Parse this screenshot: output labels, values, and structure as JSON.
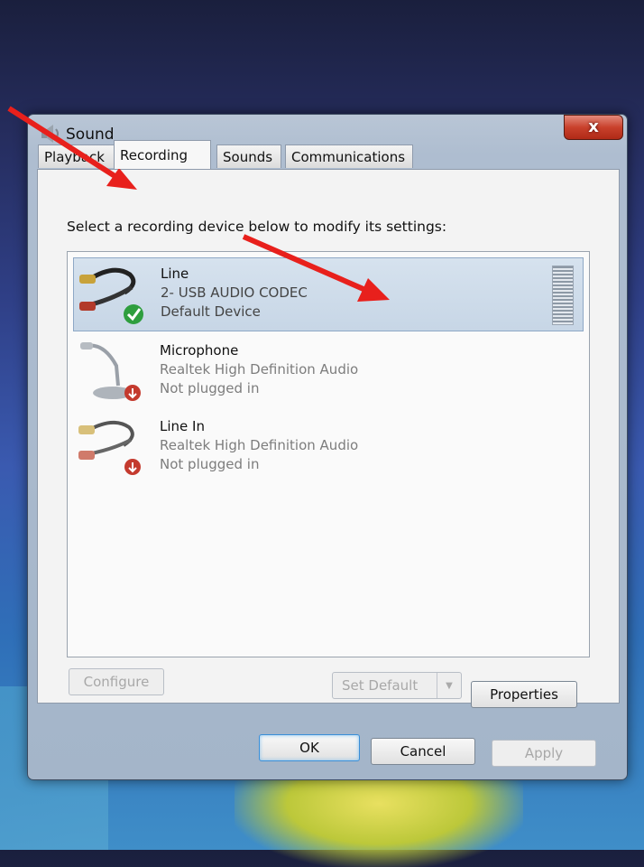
{
  "window": {
    "title": "Sound",
    "close_label": "x",
    "icon": "speaker-icon"
  },
  "tabs": [
    {
      "label": "Playback",
      "active": false
    },
    {
      "label": "Recording",
      "active": true
    },
    {
      "label": "Sounds",
      "active": false
    },
    {
      "label": "Communications",
      "active": false
    }
  ],
  "recording": {
    "instruction": "Select a recording device below to modify its settings:",
    "devices": [
      {
        "name": "Line",
        "line2": "2- USB AUDIO  CODEC",
        "line3": "Default Device",
        "selected": true,
        "status_icon": "check-icon"
      },
      {
        "name": "Microphone",
        "line2": "Realtek High Definition Audio",
        "line3": "Not plugged in",
        "selected": false,
        "status_icon": "down-arrow-icon"
      },
      {
        "name": "Line In",
        "line2": "Realtek High Definition Audio",
        "line3": "Not plugged in",
        "selected": false,
        "status_icon": "down-arrow-icon"
      }
    ],
    "buttons": {
      "configure": "Configure",
      "set_default": "Set Default",
      "properties": "Properties"
    }
  },
  "footer": {
    "ok": "OK",
    "cancel": "Cancel",
    "apply": "Apply"
  },
  "colors": {
    "annotation_arrow": "#e8201c",
    "selection": "#c7d6e6",
    "close_button": "#c9412c"
  }
}
